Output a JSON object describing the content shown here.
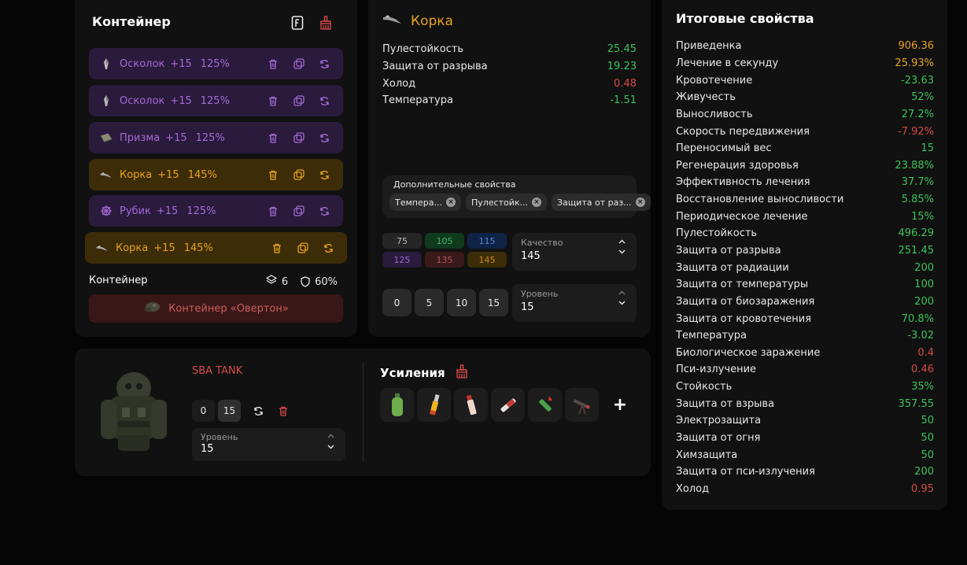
{
  "container_panel": {
    "title": "Контейнер",
    "artifacts": [
      {
        "name": "Осколок",
        "upgrade": "+15",
        "percent": "125%",
        "rarity": "purple",
        "icon": "shard-icon"
      },
      {
        "name": "Осколок",
        "upgrade": "+15",
        "percent": "125%",
        "rarity": "purple",
        "icon": "shard-icon"
      },
      {
        "name": "Призма",
        "upgrade": "+15",
        "percent": "125%",
        "rarity": "purple",
        "icon": "prism-icon"
      },
      {
        "name": "Корка",
        "upgrade": "+15",
        "percent": "145%",
        "rarity": "orange",
        "icon": "crust-icon"
      },
      {
        "name": "Рубик",
        "upgrade": "+15",
        "percent": "125%",
        "rarity": "purple",
        "icon": "rubik-icon"
      },
      {
        "name": "Корка",
        "upgrade": "+15",
        "percent": "145%",
        "rarity": "orange",
        "icon": "crust-icon"
      }
    ],
    "container_label": "Контейнер",
    "slots": "6",
    "protection": "60%",
    "container_button": "Контейнер «Овертон»"
  },
  "artifact_panel": {
    "name": "Корка",
    "stats": [
      {
        "label": "Пулестойкость",
        "value": "25.45",
        "tone": "pos"
      },
      {
        "label": "Защита от разрыва",
        "value": "19.23",
        "tone": "pos"
      },
      {
        "label": "Холод",
        "value": "0.48",
        "tone": "neg"
      },
      {
        "label": "Температура",
        "value": "-1.51",
        "tone": "pos"
      }
    ],
    "extra_title": "Дополнительные свойства",
    "extra_chips": [
      "Темпера...",
      "Пулестойк...",
      "Защита от раз..."
    ],
    "quality_grid": [
      "75",
      "105",
      "115",
      "125",
      "135",
      "145"
    ],
    "quality": {
      "label": "Качество",
      "value": "145"
    },
    "level_buttons": [
      "0",
      "5",
      "10",
      "15"
    ],
    "level": {
      "label": "Уровень",
      "value": "15"
    }
  },
  "summary_panel": {
    "title": "Итоговые свойства",
    "rows": [
      {
        "label": "Приведенка",
        "value": "906.36",
        "tone": "gold"
      },
      {
        "label": "Лечение в секунду",
        "value": "25.93%",
        "tone": "gold"
      },
      {
        "label": "Кровотечение",
        "value": "-23.63",
        "tone": "pos"
      },
      {
        "label": "Живучесть",
        "value": "52%",
        "tone": "pos"
      },
      {
        "label": "Выносливость",
        "value": "27.2%",
        "tone": "pos"
      },
      {
        "label": "Скорость передвижения",
        "value": "-7.92%",
        "tone": "neg"
      },
      {
        "label": "Переносимый вес",
        "value": "15",
        "tone": "pos"
      },
      {
        "label": "Регенерация здоровья",
        "value": "23.88%",
        "tone": "pos"
      },
      {
        "label": "Эффективность лечения",
        "value": "37.7%",
        "tone": "pos"
      },
      {
        "label": "Восстановление выносливости",
        "value": "5.85%",
        "tone": "pos"
      },
      {
        "label": "Периодическое лечение",
        "value": "15%",
        "tone": "pos"
      },
      {
        "label": "Пулестойкость",
        "value": "496.29",
        "tone": "pos"
      },
      {
        "label": "Защита от разрыва",
        "value": "251.45",
        "tone": "pos"
      },
      {
        "label": "Защита от радиации",
        "value": "200",
        "tone": "pos"
      },
      {
        "label": "Защита от температуры",
        "value": "100",
        "tone": "pos"
      },
      {
        "label": "Защита от биозаражения",
        "value": "200",
        "tone": "pos"
      },
      {
        "label": "Защита от кровотечения",
        "value": "70.8%",
        "tone": "pos"
      },
      {
        "label": "Температура",
        "value": "-3.02",
        "tone": "pos"
      },
      {
        "label": "Биологическое заражение",
        "value": "0.4",
        "tone": "neg"
      },
      {
        "label": "Пси-излучение",
        "value": "0.46",
        "tone": "neg"
      },
      {
        "label": "Стойкость",
        "value": "35%",
        "tone": "pos"
      },
      {
        "label": "Защита от взрыва",
        "value": "357.55",
        "tone": "pos"
      },
      {
        "label": "Электрозащита",
        "value": "50",
        "tone": "pos"
      },
      {
        "label": "Защита от огня",
        "value": "50",
        "tone": "pos"
      },
      {
        "label": "Химзащита",
        "value": "50",
        "tone": "pos"
      },
      {
        "label": "Защита от пси-излучения",
        "value": "200",
        "tone": "pos"
      },
      {
        "label": "Холод",
        "value": "0.95",
        "tone": "neg"
      }
    ]
  },
  "armor_panel": {
    "name": "SBA TANK",
    "level_options": [
      "0",
      "15"
    ],
    "level": {
      "label": "Уровень",
      "value": "15"
    },
    "boosts_title": "Усиления",
    "boosts": [
      "green-bottle-icon",
      "yellow-syringe-icon",
      "pink-vial-icon",
      "red-syringe-icon",
      "green-syringe-icon",
      "autoinjector-icon"
    ]
  },
  "colors": {
    "positive": "#3ec15b",
    "negative": "#d64a4a",
    "gold": "#e6a21e",
    "purple": "#a36bd6"
  }
}
